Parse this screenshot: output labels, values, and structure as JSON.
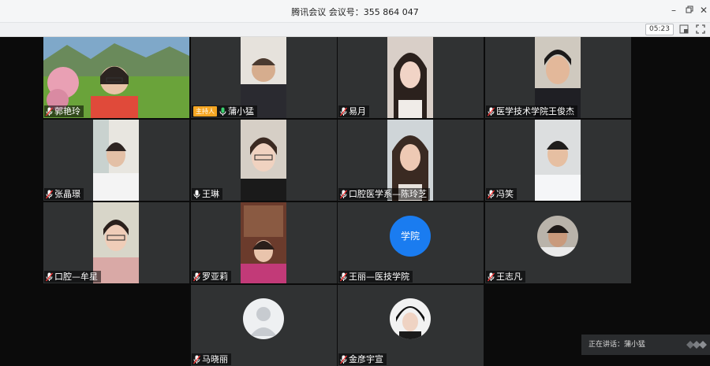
{
  "window": {
    "title": "腾讯会议 会议号：355 864 047",
    "buttons": [
      "minimize",
      "restore",
      "close"
    ]
  },
  "toolbar": {
    "timer": "05:23",
    "icons": [
      "layout-icon",
      "fullscreen-icon"
    ]
  },
  "host_badge": "主持人",
  "participants": [
    {
      "name": "郭艳玲",
      "mic": "muted",
      "video": "on"
    },
    {
      "name": "蒲小猛",
      "mic": "active",
      "video": "on",
      "host": true
    },
    {
      "name": "易月",
      "mic": "muted",
      "video": "on"
    },
    {
      "name": "医学技术学院王俊杰",
      "mic": "muted",
      "video": "on"
    },
    {
      "name": "张晶璟",
      "mic": "muted",
      "video": "on"
    },
    {
      "name": "王琳",
      "mic": "unmuted",
      "video": "on"
    },
    {
      "name": "口腔医学系—陈玲芝",
      "mic": "muted",
      "video": "on"
    },
    {
      "name": "冯笑",
      "mic": "muted",
      "video": "on"
    },
    {
      "name": "口腔—牟星",
      "mic": "muted",
      "video": "on"
    },
    {
      "name": "罗亚莉",
      "mic": "muted",
      "video": "on"
    },
    {
      "name": "王丽—医技学院",
      "mic": "muted",
      "video": "off",
      "avatar_text": "学院",
      "avatar_color": "#1a7cf0"
    },
    {
      "name": "王志凡",
      "mic": "muted",
      "video": "off"
    },
    {
      "name": "马晓丽",
      "mic": "muted",
      "video": "off"
    },
    {
      "name": "金彦宇宣",
      "mic": "muted",
      "video": "off"
    }
  ],
  "speaking_label": "正在讲话：蒲小猛"
}
